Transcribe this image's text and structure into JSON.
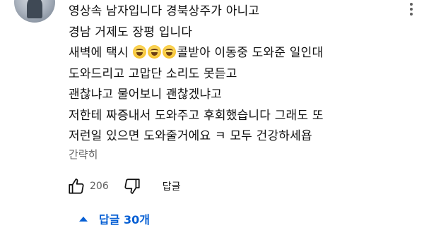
{
  "comment": {
    "lines": [
      "영상속 남자입니다 경북상주가 아니고",
      "경남 거제도 장평 입니다",
      "새벽에 택시",
      "콜받아 이동중 도와준 일인대",
      "도와드리고 고맙단 소리도 못듣고",
      "괜찮냐고 물어보니 괜찮겠냐고",
      "저한테 짜증내서 도와주고 후회했습니다 그래도 또",
      "저런일 있으면 도와줄거에요 ㅋ 모두 건강하세욥"
    ],
    "emoji_count": 3,
    "read_more": "간략히"
  },
  "actions": {
    "like_count": "206",
    "reply_label": "답글"
  },
  "replies": {
    "label": "답글 30개"
  },
  "icons": {
    "like": "thumbs-up-icon",
    "dislike": "thumbs-down-icon",
    "menu": "more-vert-icon",
    "expand": "caret-up-icon"
  },
  "colors": {
    "link": "#065fd4",
    "secondary_text": "#606060",
    "text": "#0f0f0f"
  }
}
